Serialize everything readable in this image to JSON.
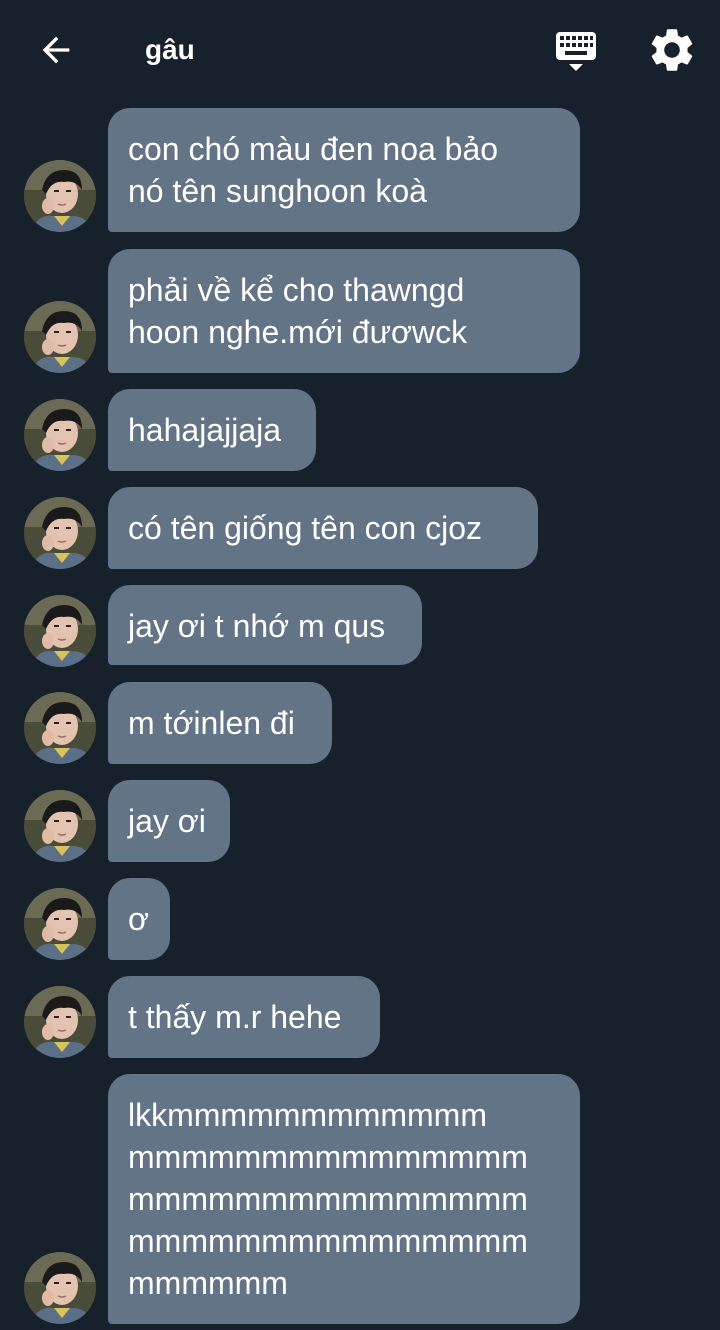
{
  "header": {
    "title": "gâu",
    "back_icon": "arrow-left-icon",
    "keyboard_icon": "keyboard-icon",
    "settings_icon": "gear-icon"
  },
  "colors": {
    "background": "#17212b",
    "bubble": "#637486",
    "text": "#ffffff"
  },
  "messages": [
    {
      "text": "con chó màu đen noa bảo\nnó tên sunghoon koà"
    },
    {
      "text": "phải về kể cho thawngd\nhoon nghe.mới đươwck"
    },
    {
      "text": "hahajajjaja"
    },
    {
      "text": "có tên giống tên con cjoz"
    },
    {
      "text": "jay ơi t nhớ m qus"
    },
    {
      "text": "m tớinlen đi"
    },
    {
      "text": "jay ơi"
    },
    {
      "text": "ơ"
    },
    {
      "text": "t thấy m.r hehe"
    },
    {
      "text": "lkkmmmmmmmmmmmm\nmmmmmmmmmmmmmmm\nmmmmmmmmmmmmmmm\nmmmmmmmmmmmmmmm\nmmmmmm"
    }
  ]
}
